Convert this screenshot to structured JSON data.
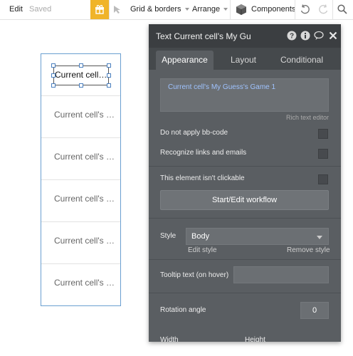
{
  "toolbar": {
    "edit": "Edit",
    "saved": "Saved",
    "gift_icon": "gift-icon",
    "cursor_icon": "cursor-icon",
    "grid": "Grid & borders",
    "arrange": "Arrange",
    "cube_icon": "cube-icon",
    "components": "Components",
    "undo_icon": "undo-icon",
    "redo_icon": "redo-icon",
    "search_icon": "search-icon"
  },
  "canvas": {
    "rows": [
      "Current cell's My Guess's Game 1",
      "Current cell's My Guess's Game 1",
      "Current cell's My Guess's Game 1",
      "Current cell's My Guess's Game 1",
      "Current cell's My Guess's Game 1",
      "Current cell's My Guess's Game 1"
    ],
    "selected_text": "Current cell's My Guess's Game 1"
  },
  "panel": {
    "title": "Text Current cell's My Gu",
    "tabs": [
      "Appearance",
      "Layout",
      "Conditional"
    ],
    "active_tab": "Appearance",
    "rich_text_value": "Current cell's My Guess's Game 1",
    "rich_text_label": "Rich text editor",
    "options": [
      {
        "label": "Do not apply bb-code",
        "checked": false
      },
      {
        "label": "Recognize links and emails",
        "checked": false
      },
      {
        "label": "This element isn't clickable",
        "checked": false
      }
    ],
    "workflow_button": "Start/Edit workflow",
    "style_label": "Style",
    "style_value": "Body",
    "edit_style": "Edit style",
    "remove_style": "Remove style",
    "tooltip_label": "Tooltip text (on hover)",
    "tooltip_value": "",
    "rotation_label": "Rotation angle",
    "rotation_value": "0",
    "width_label": "Width",
    "height_label": "Height"
  },
  "colors": {
    "gift_bg": "#f0b429",
    "panel_bg": "#5a5e62",
    "panel_header": "#3b3e41",
    "rich_text_blue": "#9fc3ff",
    "selection_border": "#6a9fd0"
  }
}
